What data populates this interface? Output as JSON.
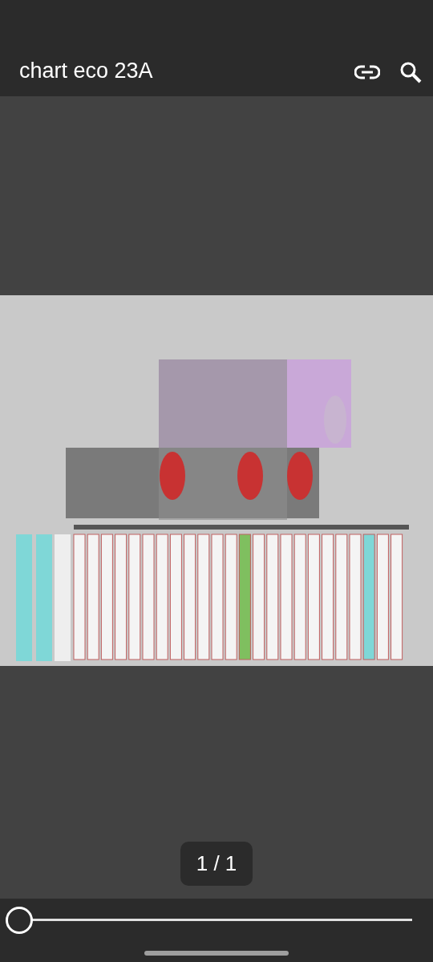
{
  "toolbar": {
    "title": "chart eco 23A"
  },
  "page_indicator": "1 / 1",
  "page_slider": {
    "level": 0
  }
}
